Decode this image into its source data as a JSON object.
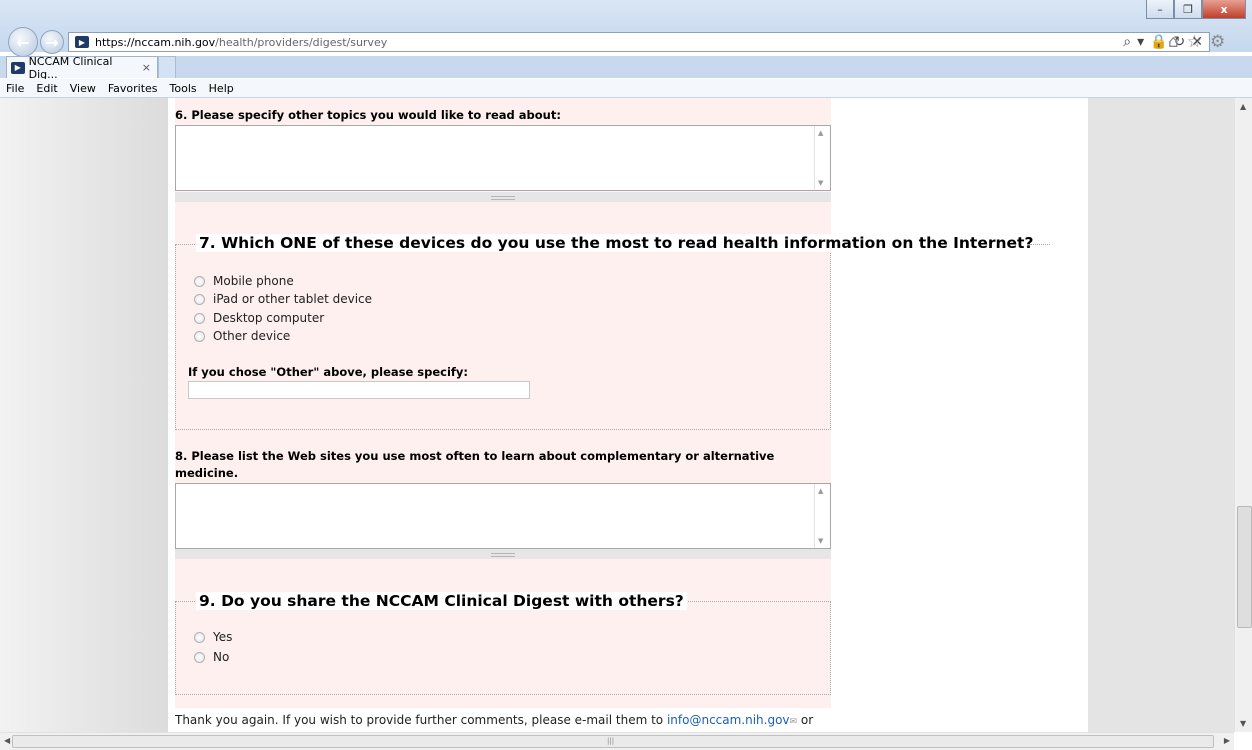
{
  "browser": {
    "url_host": "https://nccam.nih.gov",
    "url_path": "/health/providers/digest/survey",
    "tab_title": "NCCAM Clinical Dig...",
    "tab_close": "×",
    "menu": [
      "File",
      "Edit",
      "View",
      "Favorites",
      "Tools",
      "Help"
    ],
    "window_buttons": {
      "minimize": "–",
      "restore": "❐",
      "close": "x"
    }
  },
  "survey": {
    "q6_label": "6. Please specify other topics you would like to read about:",
    "q7_legend": "7. Which ONE of these devices do you use the most to read health information on the Internet?",
    "q7_options": [
      "Mobile phone",
      "iPad or other tablet device",
      "Desktop computer",
      "Other device"
    ],
    "q7_other_label": "If you chose \"Other\" above, please specify:",
    "q8_label_line1": "8. Please list the Web sites you use most often to learn about complementary or alternative",
    "q8_label_line2": "medicine.",
    "q9_legend": "9. Do you share the NCCAM Clinical Digest with others?",
    "q9_options": [
      "Yes",
      "No"
    ],
    "footer_text": "Thank you again. If you wish to provide further comments, please e-mail them to ",
    "footer_email": "info@nccam.nih.gov",
    "footer_tail": " or"
  }
}
